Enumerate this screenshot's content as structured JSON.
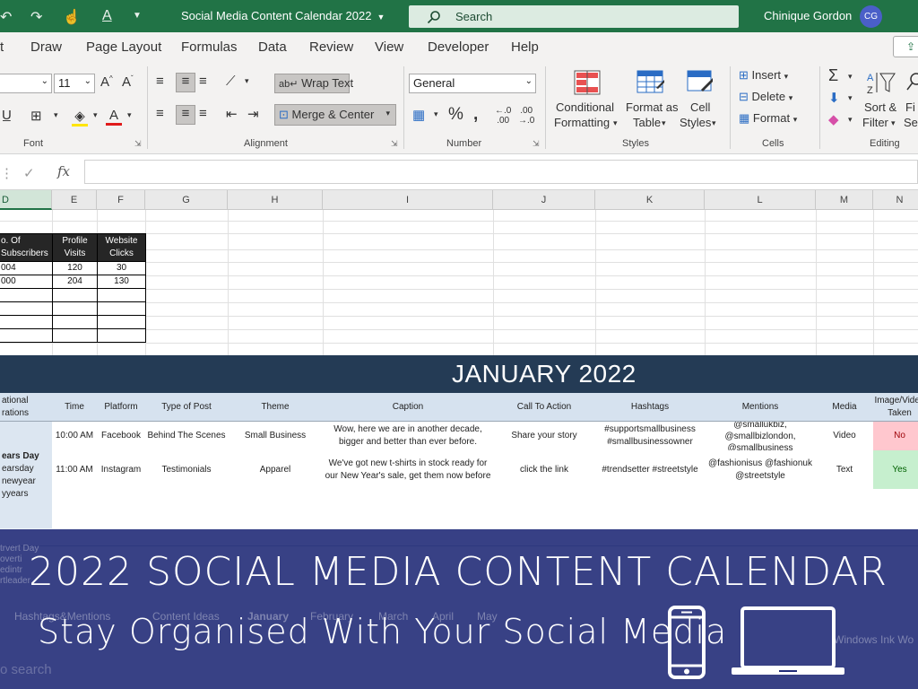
{
  "titlebar": {
    "doc_title": "Social Media Content Calendar 2022",
    "search_label": "Search",
    "user_name": "Chinique Gordon",
    "avatar_initials": "CG",
    "accent": "#217346"
  },
  "ribbon_tabs": [
    "Draw",
    "Page Layout",
    "Formulas",
    "Data",
    "Review",
    "View",
    "Developer",
    "Help"
  ],
  "ribbon": {
    "font_size": "11",
    "groups": {
      "font": "Font",
      "alignment": "Alignment",
      "number": "Number",
      "styles": "Styles",
      "cells": "Cells",
      "editing": "Editing"
    },
    "wrap_text": "Wrap Text",
    "merge_center": "Merge & Center",
    "number_format": "General",
    "conditional_formatting": [
      "Conditional",
      "Formatting"
    ],
    "format_as_table": [
      "Format as",
      "Table"
    ],
    "cell_styles": [
      "Cell",
      "Styles"
    ],
    "insert": "Insert",
    "delete": "Delete",
    "format": "Format",
    "sort_filter": [
      "Sort &",
      "Filter"
    ],
    "find_select": [
      "Fi",
      "Sel"
    ]
  },
  "formula_bar": {
    "fx": "fx"
  },
  "column_headers": [
    "D",
    "E",
    "F",
    "G",
    "H",
    "I",
    "J",
    "K",
    "L",
    "M",
    "N"
  ],
  "summary_table": {
    "headers": [
      "o. Of Subscribers",
      "Profile Visits",
      "Website Clicks"
    ],
    "rows": [
      [
        "004",
        "120",
        "30"
      ],
      [
        "000",
        "204",
        "130"
      ]
    ]
  },
  "calendar": {
    "month_title": "JANUARY 2022",
    "headers": [
      "ational rations",
      "Time",
      "Platform",
      "Type of Post",
      "Theme",
      "Caption",
      "Call To Action",
      "Hashtags",
      "Mentions",
      "Media",
      "Image/Video Taken"
    ],
    "side_text": [
      "ears Day",
      "earsday",
      "newyear",
      "yyears"
    ],
    "side_text_2": [
      "trvert Day",
      "overti",
      "edintr",
      "rtleader"
    ],
    "rows": [
      {
        "time": "10:00 AM",
        "platform": "Facebook",
        "type": "Behind The Scenes",
        "theme": "Small Business",
        "caption": [
          "Wow, here we are in another decade,",
          "bigger and better than ever before."
        ],
        "cta": "Share your story",
        "hashtags": [
          "#supportsmallbusiness",
          "#smallbusinessowner"
        ],
        "mentions": [
          "@smallukbiz,",
          "@smallbizlondon,",
          "@smallbusiness"
        ],
        "media": "Video",
        "taken": "No"
      },
      {
        "time": "11:00 AM",
        "platform": "Instagram",
        "type": "Testimonials",
        "theme": "Apparel",
        "caption": [
          "We've got new t-shirts in stock ready for",
          "our New Year's sale, get them now before"
        ],
        "cta": "click the link",
        "hashtags": [
          "#trendsetter #streetstyle"
        ],
        "mentions": [
          "@fashionisus @fashionuk",
          "@streetstyle"
        ],
        "media": "Text",
        "taken": "Yes"
      }
    ]
  },
  "sheet_tabs": [
    "Hashtags&Mentions",
    "Content Ideas",
    "January",
    "February",
    "March",
    "April",
    "May"
  ],
  "ghost": {
    "search": "o search",
    "ink": "Windows Ink Wo"
  },
  "overlay": {
    "title": "2022 SOCIAL MEDIA CONTENT CALENDAR",
    "subtitle": "Stay Organised With Your Social Media",
    "background": "#222c78"
  }
}
